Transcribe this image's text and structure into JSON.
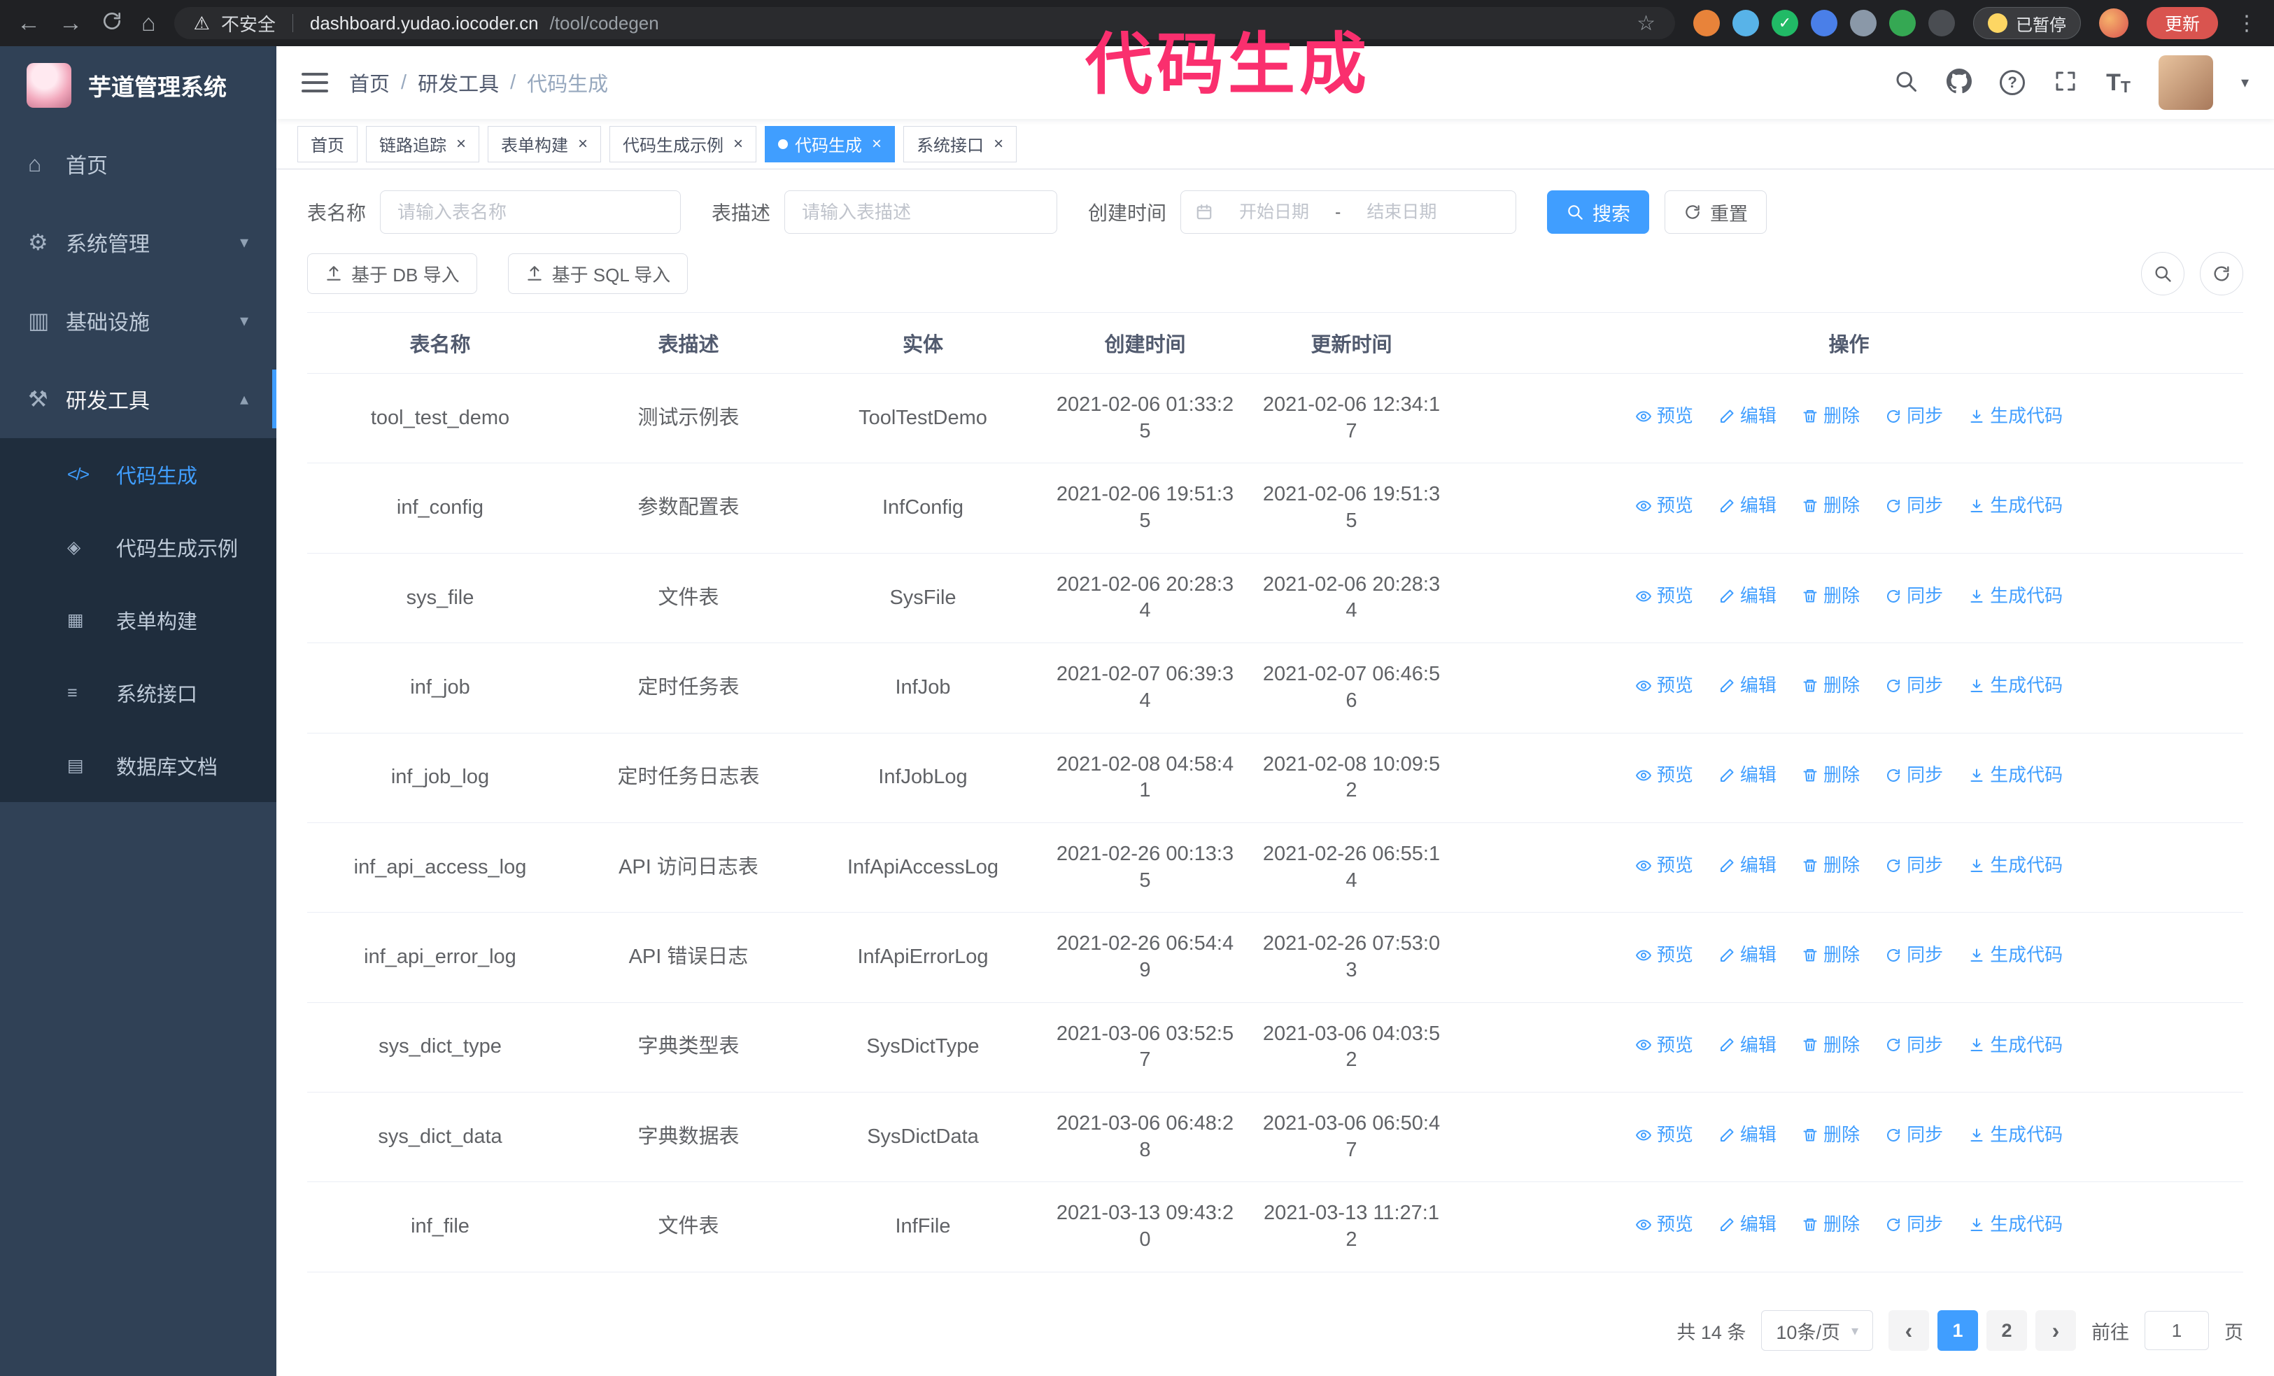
{
  "browser": {
    "back_icon": "←",
    "forward_icon": "→",
    "home_icon": "⌂",
    "security_label": "不安全",
    "url_host": "dashboard.yudao.iocoder.cn",
    "url_path": "/tool/codegen",
    "bookmark_icon": "☆",
    "extensions": [
      {
        "name": "extension-orange",
        "color": "#e8833a",
        "glyph": ""
      },
      {
        "name": "extension-lightblue",
        "color": "#58b3e8",
        "glyph": ""
      },
      {
        "name": "extension-green-check",
        "color": "#21ba66",
        "glyph": "✓"
      },
      {
        "name": "extension-blue-people",
        "color": "#4a7fe8",
        "glyph": ""
      },
      {
        "name": "extension-slate",
        "color": "#8a98a8",
        "glyph": ""
      },
      {
        "name": "extension-green-leaf",
        "color": "#35a853",
        "glyph": ""
      },
      {
        "name": "extension-dark-puzzle",
        "color": "#4a4d52",
        "glyph": ""
      }
    ],
    "paused_badge": "已暂停",
    "update_button": "更新",
    "menu_icon": "⋮"
  },
  "annotation": {
    "text": "代码生成",
    "color": "#fa2f6e"
  },
  "sidebar": {
    "logo_title": "芋道管理系统",
    "menu": [
      {
        "label": "首页",
        "icon": "home-icon",
        "glyph": "⌂"
      },
      {
        "label": "系统管理",
        "icon": "gear-icon",
        "glyph": "⚙",
        "chevron": "▾"
      },
      {
        "label": "基础设施",
        "icon": "infrastructure-icon",
        "glyph": "▥",
        "chevron": "▾"
      },
      {
        "label": "研发工具",
        "icon": "tools-icon",
        "glyph": "⚒",
        "chevron": "▴",
        "expanded": true
      }
    ],
    "submenu": [
      {
        "label": "代码生成",
        "icon": "code-icon",
        "glyph": "</>",
        "active": true
      },
      {
        "label": "代码生成示例",
        "icon": "example-icon",
        "glyph": "◈"
      },
      {
        "label": "表单构建",
        "icon": "form-builder-icon",
        "glyph": "▦"
      },
      {
        "label": "系统接口",
        "icon": "api-icon",
        "glyph": "≡"
      },
      {
        "label": "数据库文档",
        "icon": "db-doc-icon",
        "glyph": "▤"
      }
    ]
  },
  "header": {
    "breadcrumb": [
      "首页",
      "研发工具",
      "代码生成"
    ],
    "separator": "/"
  },
  "tabs": [
    {
      "label": "首页"
    },
    {
      "label": "链路追踪",
      "closable": true
    },
    {
      "label": "表单构建",
      "closable": true
    },
    {
      "label": "代码生成示例",
      "closable": true
    },
    {
      "label": "代码生成",
      "closable": true,
      "active": true
    },
    {
      "label": "系统接口",
      "closable": true
    }
  ],
  "filters": {
    "table_name_label": "表名称",
    "table_name_placeholder": "请输入表名称",
    "table_desc_label": "表描述",
    "table_desc_placeholder": "请输入表描述",
    "create_time_label": "创建时间",
    "date_start_placeholder": "开始日期",
    "date_separator": "-",
    "date_end_placeholder": "结束日期",
    "search_button": "搜索",
    "reset_button": "重置"
  },
  "toolbar": {
    "import_db_button": "基于 DB 导入",
    "import_sql_button": "基于 SQL 导入"
  },
  "table": {
    "columns": [
      "表名称",
      "表描述",
      "实体",
      "创建时间",
      "更新时间",
      "操作"
    ],
    "actions": [
      "预览",
      "编辑",
      "删除",
      "同步",
      "生成代码"
    ],
    "rows": [
      {
        "name": "tool_test_demo",
        "desc": "测试示例表",
        "entity": "ToolTestDemo",
        "created": "2021-02-06 01:33:25",
        "updated": "2021-02-06 12:34:17"
      },
      {
        "name": "inf_config",
        "desc": "参数配置表",
        "entity": "InfConfig",
        "created": "2021-02-06 19:51:35",
        "updated": "2021-02-06 19:51:35"
      },
      {
        "name": "sys_file",
        "desc": "文件表",
        "entity": "SysFile",
        "created": "2021-02-06 20:28:34",
        "updated": "2021-02-06 20:28:34"
      },
      {
        "name": "inf_job",
        "desc": "定时任务表",
        "entity": "InfJob",
        "created": "2021-02-07 06:39:34",
        "updated": "2021-02-07 06:46:56"
      },
      {
        "name": "inf_job_log",
        "desc": "定时任务日志表",
        "entity": "InfJobLog",
        "created": "2021-02-08 04:58:41",
        "updated": "2021-02-08 10:09:52"
      },
      {
        "name": "inf_api_access_log",
        "desc": "API 访问日志表",
        "entity": "InfApiAccessLog",
        "created": "2021-02-26 00:13:35",
        "updated": "2021-02-26 06:55:14"
      },
      {
        "name": "inf_api_error_log",
        "desc": "API 错误日志",
        "entity": "InfApiErrorLog",
        "created": "2021-02-26 06:54:49",
        "updated": "2021-02-26 07:53:03"
      },
      {
        "name": "sys_dict_type",
        "desc": "字典类型表",
        "entity": "SysDictType",
        "created": "2021-03-06 03:52:57",
        "updated": "2021-03-06 04:03:52"
      },
      {
        "name": "sys_dict_data",
        "desc": "字典数据表",
        "entity": "SysDictData",
        "created": "2021-03-06 06:48:28",
        "updated": "2021-03-06 06:50:47"
      },
      {
        "name": "inf_file",
        "desc": "文件表",
        "entity": "InfFile",
        "created": "2021-03-13 09:43:20",
        "updated": "2021-03-13 11:27:12"
      }
    ]
  },
  "pagination": {
    "total": "共 14 条",
    "page_size": "10条/页",
    "prev_icon": "‹",
    "next_icon": "›",
    "pages": [
      {
        "label": "1",
        "active": true
      },
      {
        "label": "2"
      }
    ],
    "goto_label": "前往",
    "goto_value": "1",
    "page_suffix": "页",
    "accent_color": "#409eff"
  }
}
